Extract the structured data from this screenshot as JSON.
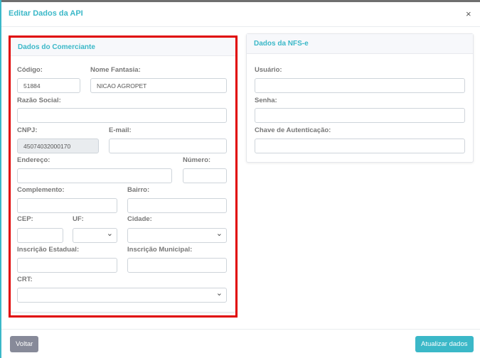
{
  "modal": {
    "title": "Editar Dados da API",
    "close": "×"
  },
  "merchant": {
    "title": "Dados do Comerciante",
    "codigo_label": "Código:",
    "codigo_value": "51884",
    "nome_label": "Nome Fantasia:",
    "nome_value": "NICAO AGROPET",
    "razao_label": "Razão Social:",
    "cnpj_label": "CNPJ:",
    "cnpj_value": "45074032000170",
    "email_label": "E-mail:",
    "endereco_label": "Endereço:",
    "numero_label": "Número:",
    "complemento_label": "Complemento:",
    "bairro_label": "Bairro:",
    "cep_label": "CEP:",
    "uf_label": "UF:",
    "cidade_label": "Cidade:",
    "ie_label": "Inscrição Estadual:",
    "im_label": "Inscrição Municipal:",
    "crt_label": "CRT:"
  },
  "nfse": {
    "title": "Dados da NFS-e",
    "usuario_label": "Usuário:",
    "senha_label": "Senha:",
    "chave_label": "Chave de Autenticação:"
  },
  "footer": {
    "back": "Voltar",
    "update": "Atualizar dados"
  }
}
